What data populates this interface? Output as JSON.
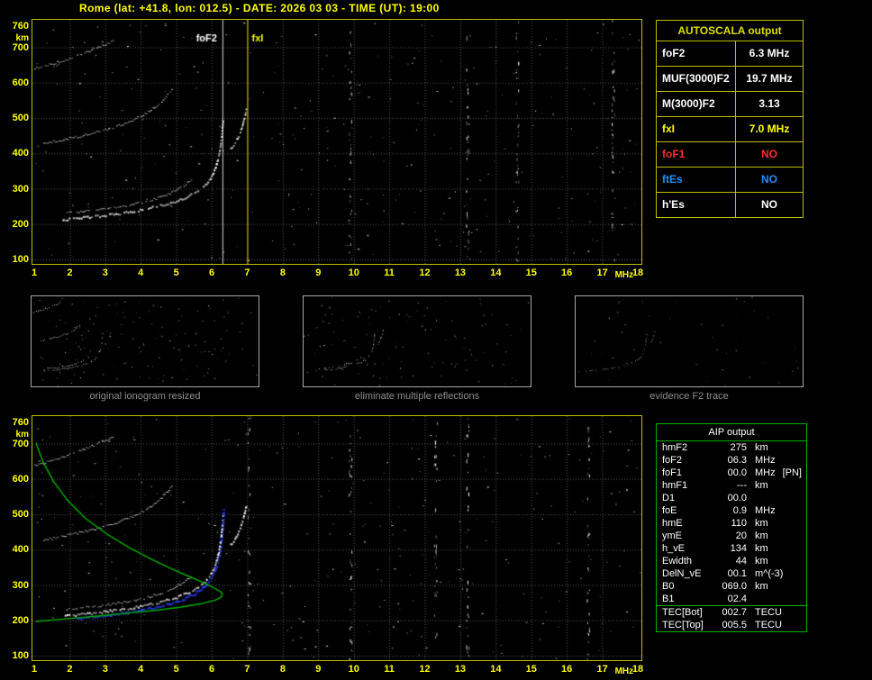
{
  "title": "Rome (lat: +41.8, lon: 012.5) - DATE: 2026 03 03 - TIME (UT): 19:00",
  "autoscala_table": {
    "header": "AUTOSCALA output",
    "rows": [
      {
        "label": "foF2",
        "value": "6.3 MHz",
        "color": "#ffffff"
      },
      {
        "label": "MUF(3000)F2",
        "value": "19.7 MHz",
        "color": "#ffffff"
      },
      {
        "label": "M(3000)F2",
        "value": "3.13",
        "color": "#ffffff"
      },
      {
        "label": "fxI",
        "value": "7.0 MHz",
        "color": "#ffff00"
      },
      {
        "label": "foF1",
        "value": "NO",
        "color": "#ff2a2a"
      },
      {
        "label": "ftEs",
        "value": "NO",
        "color": "#1e8fff"
      },
      {
        "label": "h'Es",
        "value": "NO",
        "color": "#ffffff"
      }
    ]
  },
  "thumbnails": [
    {
      "caption": "original ionogram resized"
    },
    {
      "caption": "eliminate multiple reflections"
    },
    {
      "caption": "evidence F2 trace"
    }
  ],
  "aip_table": {
    "header": "AIP output",
    "rows": [
      {
        "label": "hmF2",
        "value": "275",
        "unit": "km",
        "note": ""
      },
      {
        "label": "foF2",
        "value": "06.3",
        "unit": "MHz",
        "note": ""
      },
      {
        "label": "foF1",
        "value": "00.0",
        "unit": "MHz",
        "note": "[PN]"
      },
      {
        "label": "hmF1",
        "value": "---",
        "unit": "km",
        "note": ""
      },
      {
        "label": "D1",
        "value": "00.0",
        "unit": "",
        "note": ""
      },
      {
        "label": "foE",
        "value": "0.9",
        "unit": "MHz",
        "note": ""
      },
      {
        "label": "hmE",
        "value": "110",
        "unit": "km",
        "note": ""
      },
      {
        "label": "ymE",
        "value": "20",
        "unit": "km",
        "note": ""
      },
      {
        "label": "h_vE",
        "value": "134",
        "unit": "km",
        "note": ""
      },
      {
        "label": "Ewidth",
        "value": "44",
        "unit": "km",
        "note": ""
      },
      {
        "label": "DelN_vE",
        "value": "00.1",
        "unit": "m^(-3)",
        "note": ""
      },
      {
        "label": "B0",
        "value": "069.0",
        "unit": "km",
        "note": ""
      },
      {
        "label": "B1",
        "value": "02.4",
        "unit": "",
        "note": ""
      },
      {
        "label": "TEC[Bot]",
        "value": "002.7",
        "unit": "TECU",
        "note": "",
        "separator": true
      },
      {
        "label": "TEC[Top]",
        "value": "005.5",
        "unit": "TECU",
        "note": ""
      }
    ]
  },
  "chart_data": [
    {
      "id": "top_ionogram",
      "type": "scatter",
      "title": "scaled ionogram",
      "xlabel": "MHz",
      "ylabel": "km",
      "xlim": [
        1,
        18
      ],
      "ylim": [
        100,
        760
      ],
      "xticks": [
        1,
        2,
        3,
        4,
        5,
        6,
        7,
        8,
        9,
        10,
        11,
        12,
        13,
        14,
        15,
        16,
        17,
        18
      ],
      "yticks": [
        760,
        700,
        600,
        500,
        400,
        300,
        200,
        100
      ],
      "grid": true,
      "markers": [
        {
          "label": "foF2",
          "freq": 6.3,
          "color": "#ffffff",
          "side": "left"
        },
        {
          "label": "fxI",
          "freq": 7.0,
          "color": "#ffff00",
          "side": "right"
        }
      ],
      "rfi_columns": [
        9.9,
        13.2,
        14.6,
        17.3
      ],
      "series": [
        {
          "name": "third-hop echo",
          "color": "#d8d8d8",
          "weight": 1,
          "points": [
            [
              1.0,
              640
            ],
            [
              1.35,
              650
            ],
            [
              1.75,
              662
            ],
            [
              2.15,
              676
            ],
            [
              2.55,
              692
            ],
            [
              2.95,
              708
            ],
            [
              3.25,
              720
            ]
          ]
        },
        {
          "name": "second-hop echo",
          "color": "#e0e0e0",
          "weight": 1,
          "points": [
            [
              1.25,
              428
            ],
            [
              1.7,
              438
            ],
            [
              2.2,
              448
            ],
            [
              2.7,
              460
            ],
            [
              3.2,
              474
            ],
            [
              3.7,
              492
            ],
            [
              4.1,
              512
            ],
            [
              4.45,
              537
            ],
            [
              4.7,
              562
            ],
            [
              4.9,
              585
            ]
          ]
        },
        {
          "name": "F2 trace inner branch",
          "color": "#e8e8e8",
          "weight": 1,
          "points": [
            [
              1.9,
              232
            ],
            [
              2.4,
              237
            ],
            [
              2.9,
              243
            ],
            [
              3.4,
              250
            ],
            [
              3.9,
              259
            ],
            [
              4.3,
              270
            ],
            [
              4.7,
              283
            ],
            [
              5.0,
              297
            ],
            [
              5.25,
              313
            ],
            [
              5.45,
              330
            ]
          ]
        },
        {
          "name": "F2 trace O-mode",
          "color": "#ffffff",
          "weight": 2,
          "points": [
            [
              1.8,
              214
            ],
            [
              2.2,
              218
            ],
            [
              2.6,
              222
            ],
            [
              3.0,
              227
            ],
            [
              3.4,
              232
            ],
            [
              3.8,
              238
            ],
            [
              4.2,
              246
            ],
            [
              4.6,
              255
            ],
            [
              5.0,
              267
            ],
            [
              5.3,
              279
            ],
            [
              5.6,
              295
            ],
            [
              5.8,
              312
            ],
            [
              5.95,
              332
            ],
            [
              6.08,
              358
            ],
            [
              6.17,
              390
            ],
            [
              6.23,
              425
            ],
            [
              6.27,
              462
            ],
            [
              6.3,
              500
            ]
          ]
        },
        {
          "name": "F2 X-mode cusp",
          "color": "#ffffff",
          "weight": 2,
          "points": [
            [
              6.52,
              415
            ],
            [
              6.64,
              432
            ],
            [
              6.74,
              452
            ],
            [
              6.83,
              476
            ],
            [
              6.9,
              503
            ],
            [
              6.96,
              532
            ]
          ]
        }
      ]
    },
    {
      "id": "bottom_ionogram",
      "type": "scatter",
      "title": "ionogram with restored trace and electron density profile",
      "xlabel": "MHz",
      "ylabel": "km",
      "xlim": [
        1,
        18
      ],
      "ylim": [
        100,
        760
      ],
      "xticks": [
        1,
        2,
        3,
        4,
        5,
        6,
        7,
        8,
        9,
        10,
        11,
        12,
        13,
        14,
        15,
        16,
        17,
        18
      ],
      "yticks": [
        760,
        700,
        600,
        500,
        400,
        300,
        200,
        100
      ],
      "grid": true,
      "markers": [],
      "rfi_columns": [
        7.05,
        9.9,
        12.3,
        13.2,
        16.6
      ],
      "series": [
        {
          "name": "third-hop echo",
          "color": "#d8d8d8",
          "weight": 1,
          "points": [
            [
              1.0,
              640
            ],
            [
              1.35,
              650
            ],
            [
              1.75,
              662
            ],
            [
              2.15,
              676
            ],
            [
              2.55,
              692
            ],
            [
              2.95,
              708
            ],
            [
              3.25,
              720
            ]
          ]
        },
        {
          "name": "second-hop echo",
          "color": "#e0e0e0",
          "weight": 1,
          "points": [
            [
              1.25,
              428
            ],
            [
              1.7,
              438
            ],
            [
              2.2,
              448
            ],
            [
              2.7,
              460
            ],
            [
              3.2,
              474
            ],
            [
              3.7,
              492
            ],
            [
              4.1,
              512
            ],
            [
              4.45,
              537
            ],
            [
              4.7,
              562
            ],
            [
              4.9,
              585
            ]
          ]
        },
        {
          "name": "F2 trace inner branch",
          "color": "#e8e8e8",
          "weight": 1,
          "points": [
            [
              1.9,
              232
            ],
            [
              2.4,
              237
            ],
            [
              2.9,
              243
            ],
            [
              3.4,
              250
            ],
            [
              3.9,
              259
            ],
            [
              4.3,
              270
            ],
            [
              4.7,
              283
            ],
            [
              5.0,
              297
            ],
            [
              5.25,
              313
            ],
            [
              5.45,
              330
            ]
          ]
        },
        {
          "name": "restored F2 trace",
          "color": "#2a3cff",
          "weight": 3,
          "points": [
            [
              2.2,
              206
            ],
            [
              2.8,
              213
            ],
            [
              3.4,
              221
            ],
            [
              4.0,
              231
            ],
            [
              4.6,
              243
            ],
            [
              5.1,
              258
            ],
            [
              5.5,
              277
            ],
            [
              5.8,
              300
            ],
            [
              6.0,
              328
            ],
            [
              6.13,
              362
            ],
            [
              6.21,
              400
            ],
            [
              6.26,
              442
            ],
            [
              6.29,
              484
            ],
            [
              6.31,
              520
            ]
          ]
        },
        {
          "name": "F2 trace O-mode",
          "color": "#ffffff",
          "weight": 2,
          "points": [
            [
              1.8,
              214
            ],
            [
              2.2,
              218
            ],
            [
              2.6,
              222
            ],
            [
              3.0,
              227
            ],
            [
              3.4,
              232
            ],
            [
              3.8,
              238
            ],
            [
              4.2,
              246
            ],
            [
              4.6,
              255
            ],
            [
              5.0,
              267
            ],
            [
              5.3,
              279
            ],
            [
              5.6,
              295
            ],
            [
              5.8,
              312
            ],
            [
              5.95,
              332
            ],
            [
              6.08,
              358
            ],
            [
              6.17,
              390
            ],
            [
              6.23,
              425
            ],
            [
              6.27,
              462
            ],
            [
              6.3,
              500
            ]
          ]
        },
        {
          "name": "F2 X-mode cusp",
          "color": "#ffffff",
          "weight": 2,
          "points": [
            [
              6.52,
              415
            ],
            [
              6.64,
              432
            ],
            [
              6.74,
              452
            ],
            [
              6.83,
              476
            ],
            [
              6.9,
              503
            ],
            [
              6.96,
              532
            ]
          ]
        },
        {
          "name": "electron density profile",
          "color": "#00b400",
          "style": "line",
          "points": [
            [
              1.05,
              702
            ],
            [
              1.25,
              648
            ],
            [
              1.55,
              592
            ],
            [
              1.95,
              538
            ],
            [
              2.45,
              488
            ],
            [
              3.05,
              444
            ],
            [
              3.7,
              404
            ],
            [
              4.4,
              368
            ],
            [
              5.0,
              340
            ],
            [
              5.55,
              316
            ],
            [
              6.0,
              295
            ],
            [
              6.25,
              281
            ],
            [
              6.3,
              275
            ],
            [
              6.27,
              266
            ],
            [
              6.1,
              257
            ],
            [
              5.7,
              247
            ],
            [
              5.1,
              237
            ],
            [
              4.4,
              228
            ],
            [
              3.6,
              220
            ],
            [
              2.8,
              212
            ],
            [
              2.1,
              206
            ],
            [
              1.5,
              201
            ],
            [
              1.05,
              197
            ]
          ]
        }
      ]
    }
  ]
}
